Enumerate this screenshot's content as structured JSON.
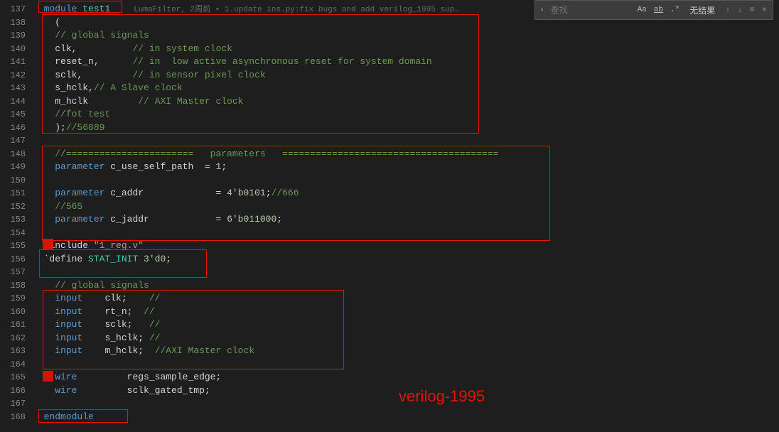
{
  "findbar": {
    "placeholder": "查找",
    "opt_case": "Aa",
    "opt_word": "ab",
    "opt_regex": ".*",
    "no_result": "无结果"
  },
  "gutter": {
    "start": 137,
    "end": 168
  },
  "codelens": "LumaFilter, 2周前 • 1.update ins.py:fix bugs and add verilog_1995 sup…",
  "code": {
    "l137": {
      "kw": "module",
      "ident": "test1"
    },
    "l138": {
      "plain": "("
    },
    "l139": {
      "comment": "// global signals"
    },
    "l140": {
      "a": "clk,",
      "c": "// in system clock"
    },
    "l141": {
      "a": "reset_n,",
      "c": "// in  low active asynchronous reset for system domain"
    },
    "l142": {
      "a": "sclk,",
      "c": "// in sensor pixel clock"
    },
    "l143": {
      "a": "s_hclk,",
      "c": "// A Slave clock"
    },
    "l144": {
      "a": "m_hclk",
      "c": "// AXI Master clock"
    },
    "l145": {
      "c": "//fot test"
    },
    "l146": {
      "a": ");",
      "c": "//56889"
    },
    "l148": {
      "c": "//=======================   parameters   ======================================="
    },
    "l149": {
      "kw": "parameter",
      "name": "c_use_self_path",
      "eq": "  = ",
      "val": "1",
      "semi": ";"
    },
    "l151": {
      "kw": "parameter",
      "name": "c_addr",
      "pad": "             = ",
      "val": "4'b0101",
      "semi": ";",
      "c": "//666"
    },
    "l152": {
      "c": "//565"
    },
    "l153": {
      "kw": "parameter",
      "name": "c_jaddr",
      "pad": "            = ",
      "val": "6'b011000",
      "semi": ";"
    },
    "l155": {
      "tick": "`include ",
      "str": "\"1_reg.v\""
    },
    "l156": {
      "tick": "`define ",
      "name": "STAT_INIT ",
      "val": "3'd0",
      "semi": ";"
    },
    "l158": {
      "c": "// global signals"
    },
    "l159": {
      "kw": "input",
      "name": "    clk;",
      "c": "    //"
    },
    "l160": {
      "kw": "input",
      "name": "    rt_n;",
      "c": "  //"
    },
    "l161": {
      "kw": "input",
      "name": "    sclk;",
      "c": "   //"
    },
    "l162": {
      "kw": "input",
      "name": "    s_hclk;",
      "c": " //"
    },
    "l163": {
      "kw": "input",
      "name": "    m_hclk;",
      "c": "  //AXI Master clock"
    },
    "l165": {
      "kw": "wire",
      "name": "         regs_sample_edge;"
    },
    "l166": {
      "kw": "wire",
      "name": "         sclk_gated_tmp;"
    },
    "l168": {
      "kw": "endmodule"
    }
  },
  "annotation": "verilog-1995"
}
